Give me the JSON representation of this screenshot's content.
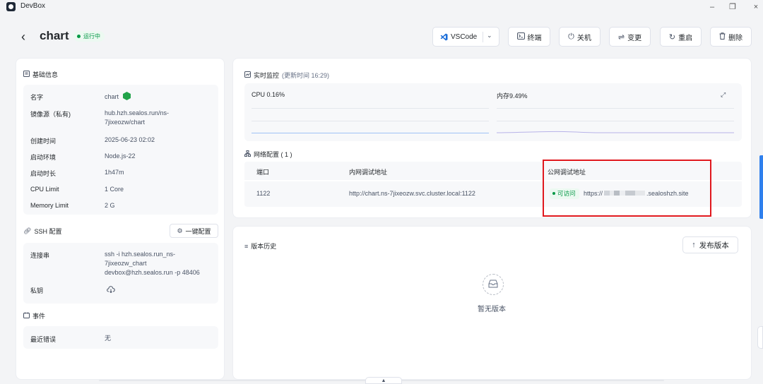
{
  "window": {
    "app_name": "DevBox",
    "minimize": "–",
    "restore": "❐",
    "close": "×"
  },
  "header": {
    "back": "‹",
    "title": "chart",
    "status": "运行中",
    "buttons": {
      "vscode": "VSCode",
      "terminal": "终端",
      "shutdown": "关机",
      "change": "变更",
      "restart": "重启",
      "delete": "删除"
    }
  },
  "basic_info": {
    "title": "基础信息",
    "rows": [
      {
        "label": "名字",
        "value": "chart"
      },
      {
        "label": "镜像源（私有)",
        "value": "hub.hzh.sealos.run/ns-7jixeozw/chart"
      },
      {
        "label": "创建时间",
        "value": "2025-06-23 02:02"
      },
      {
        "label": "启动环境",
        "value": "Node.js-22"
      },
      {
        "label": "启动时长",
        "value": "1h47m"
      },
      {
        "label": "CPU Limit",
        "value": "1 Core"
      },
      {
        "label": "Memory Limit",
        "value": "2 G"
      }
    ]
  },
  "ssh": {
    "title": "SSH 配置",
    "one_key_button": "一键配置",
    "connect_label": "连接串",
    "connect_value": "ssh -i hzh.sealos.run_ns-7jixeozw_chart devbox@hzh.sealos.run -p 48406",
    "key_label": "私钥"
  },
  "events": {
    "title": "事件",
    "recent_error_label": "最近错误",
    "recent_error_value": "无"
  },
  "monitor": {
    "title": "实时监控",
    "updated": "(更新时间  16:29)",
    "cpu": "CPU 0.16%",
    "memory": "内存9.49%"
  },
  "network": {
    "title": "网络配置 ( 1 )",
    "headers": {
      "port": "端口",
      "internal": "内网调试地址",
      "public": "公网调试地址"
    },
    "row": {
      "port": "1122",
      "internal": "http://chart.ns-7jixeozw.svc.cluster.local:1122",
      "reachable": "可访问",
      "public_prefix": "https://",
      "public_suffix": ".sealoshzh.site"
    }
  },
  "history": {
    "title": "版本历史",
    "publish_button": "发布版本",
    "empty": "暂无版本"
  },
  "colors": {
    "accent": "#2f80ed",
    "running_green": "#039845",
    "highlight_red": "#e0181e",
    "cpu_line": "#9ec2f5",
    "mem_line": "#b7b2e8"
  }
}
